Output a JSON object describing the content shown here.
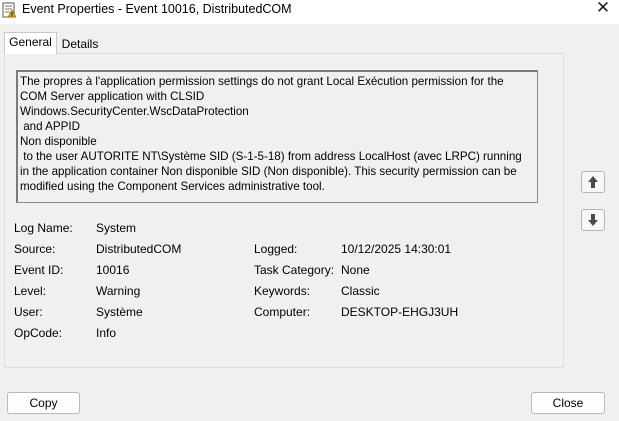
{
  "window": {
    "title": "Event Properties - Event 10016, DistributedCOM",
    "close_glyph": "✕"
  },
  "tabs": [
    {
      "label": "General",
      "active": true
    },
    {
      "label": "Details",
      "active": false
    }
  ],
  "description": "The propres à l'application permission settings do not grant Local Exécution permission for the COM Server application with CLSID\nWindows.SecurityCenter.WscDataProtection\n and APPID\nNon disponible\n to the user AUTORITE NT\\Système SID (S-1-5-18) from address LocalHost (avec LRPC) running in the application container Non disponible SID (Non disponible). This security permission can be modified using the Component Services administrative tool.",
  "fields": {
    "log_name": {
      "label": "Log Name:",
      "value": "System"
    },
    "source": {
      "label": "Source:",
      "value": "DistributedCOM"
    },
    "logged": {
      "label": "Logged:",
      "value": "10/12/2025 14:30:01"
    },
    "event_id": {
      "label": "Event ID:",
      "value": "10016"
    },
    "task_category": {
      "label": "Task Category:",
      "value": "None"
    },
    "level": {
      "label": "Level:",
      "value": "Warning"
    },
    "keywords": {
      "label": "Keywords:",
      "value": "Classic"
    },
    "user": {
      "label": "User:",
      "value": "Système"
    },
    "computer": {
      "label": "Computer:",
      "value": "DESKTOP-EHGJ3UH"
    },
    "opcode": {
      "label": "OpCode:",
      "value": "Info"
    }
  },
  "buttons": {
    "copy": "Copy",
    "close": "Close"
  },
  "icons": {
    "app": "event-log-icon",
    "up": "arrow-up-icon",
    "down": "arrow-down-icon"
  },
  "colors": {
    "background": "#f0f0f0",
    "titlebar": "#ffffff",
    "border": "#8a8a8a",
    "icon_accent": "#e0b000"
  }
}
